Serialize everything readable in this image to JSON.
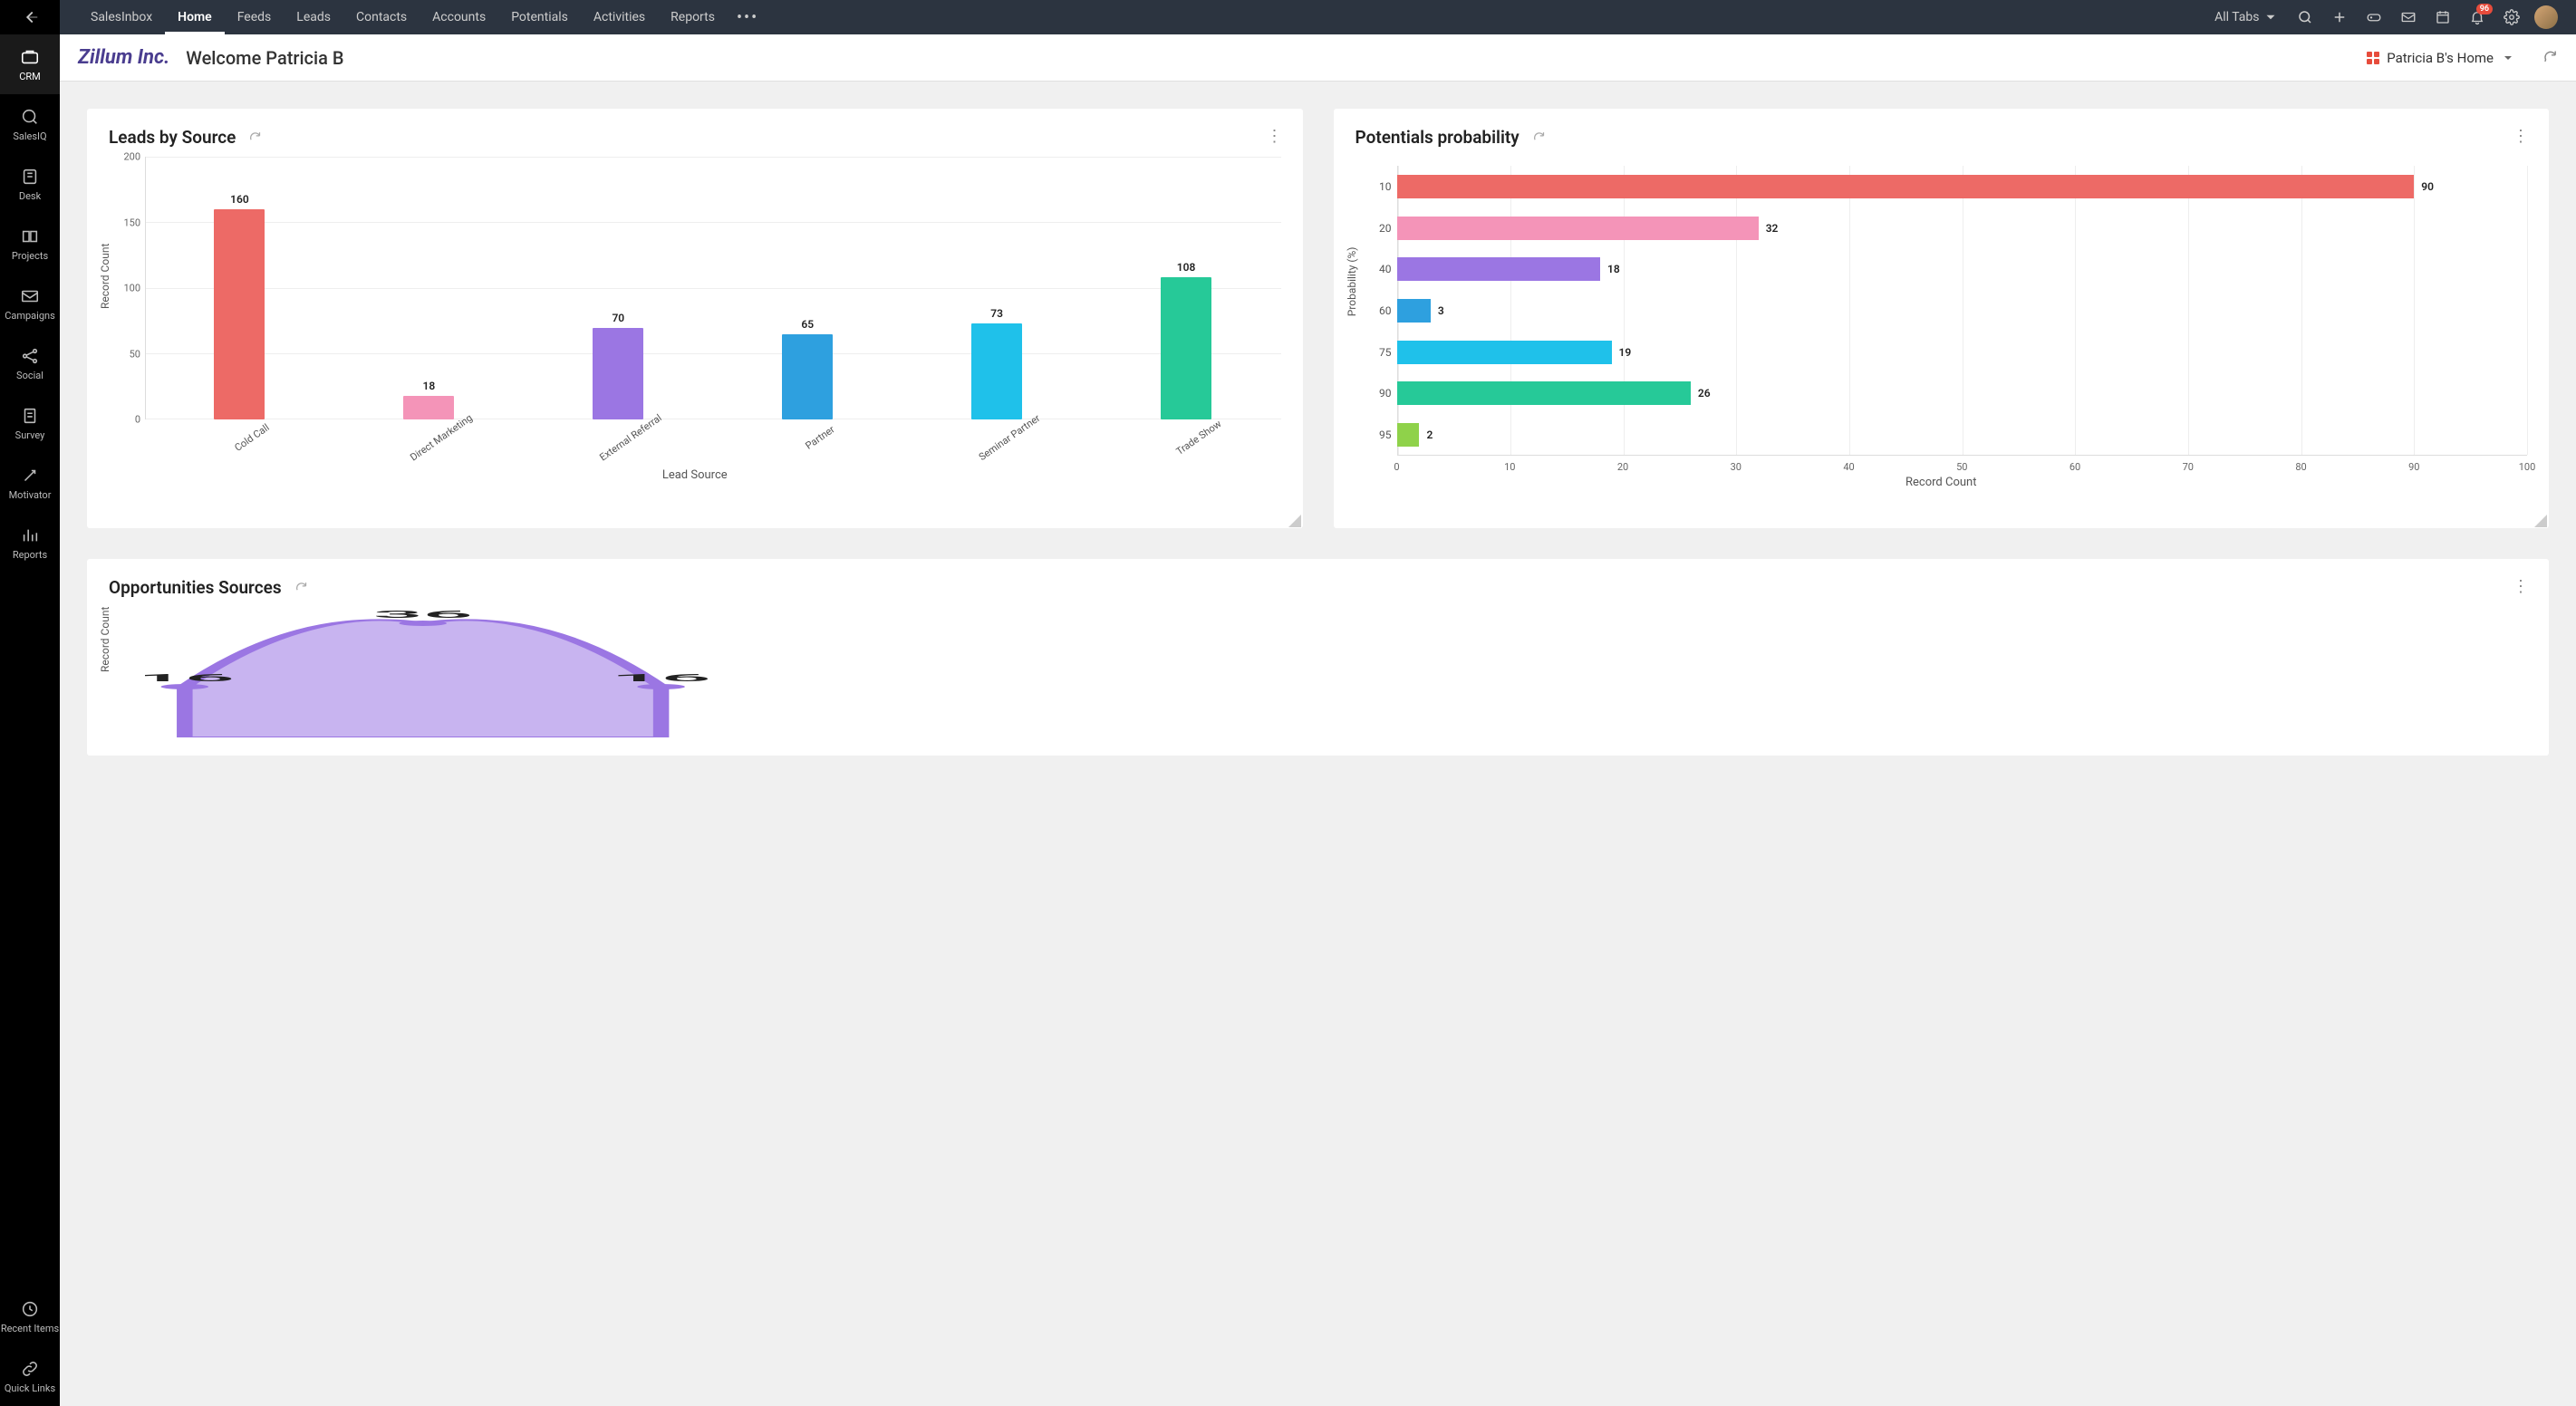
{
  "sidebar": {
    "items": [
      {
        "label": "CRM"
      },
      {
        "label": "SalesIQ"
      },
      {
        "label": "Desk"
      },
      {
        "label": "Projects"
      },
      {
        "label": "Campaigns"
      },
      {
        "label": "Social"
      },
      {
        "label": "Survey"
      },
      {
        "label": "Motivator"
      },
      {
        "label": "Reports"
      }
    ],
    "bottom": [
      {
        "label": "Recent Items"
      },
      {
        "label": "Quick Links"
      }
    ]
  },
  "topnav": {
    "tabs": [
      "SalesInbox",
      "Home",
      "Feeds",
      "Leads",
      "Contacts",
      "Accounts",
      "Potentials",
      "Activities",
      "Reports"
    ],
    "active": "Home",
    "all_tabs_label": "All Tabs",
    "notification_count": "96"
  },
  "header": {
    "company": "Zillum Inc.",
    "welcome": "Welcome Patricia B",
    "home_select": "Patricia B's Home"
  },
  "cards": {
    "leads_by_source": {
      "title": "Leads by Source"
    },
    "potentials": {
      "title": "Potentials probability"
    },
    "opportunities": {
      "title": "Opportunities Sources"
    }
  },
  "chart_data": [
    {
      "id": "leads_by_source",
      "type": "bar",
      "title": "Leads by Source",
      "xlabel": "Lead Source",
      "ylabel": "Record Count",
      "ylim": [
        0,
        200
      ],
      "yticks": [
        0,
        50,
        100,
        150,
        200
      ],
      "categories": [
        "Cold Call",
        "Direct Marketing",
        "External Referral",
        "Partner",
        "Seminar Partner",
        "Trade Show"
      ],
      "values": [
        160,
        18,
        70,
        65,
        73,
        108
      ],
      "colors": [
        "#ed6a66",
        "#f494b8",
        "#9b76e3",
        "#2ea0df",
        "#1fc1ea",
        "#26c998"
      ]
    },
    {
      "id": "potentials_probability",
      "type": "bar",
      "orientation": "horizontal",
      "title": "Potentials probability",
      "xlabel": "Record Count",
      "ylabel": "Probability (%)",
      "xlim": [
        0,
        100
      ],
      "xticks": [
        0,
        10,
        20,
        30,
        40,
        50,
        60,
        70,
        80,
        90,
        100
      ],
      "categories": [
        "10",
        "20",
        "40",
        "60",
        "75",
        "90",
        "95"
      ],
      "values": [
        90,
        32,
        18,
        3,
        19,
        26,
        2
      ],
      "colors": [
        "#ed6a66",
        "#f494b8",
        "#9b76e3",
        "#2ea0df",
        "#1fc1ea",
        "#26c998",
        "#8fd24a"
      ]
    },
    {
      "id": "opportunities_sources",
      "type": "area",
      "title": "Opportunities Sources",
      "ylabel": "Record Count",
      "yticks": [
        20,
        40
      ],
      "categories": [
        "",
        "",
        ""
      ],
      "values": [
        16,
        36,
        16
      ],
      "colors": [
        "#9b76e3"
      ]
    }
  ]
}
